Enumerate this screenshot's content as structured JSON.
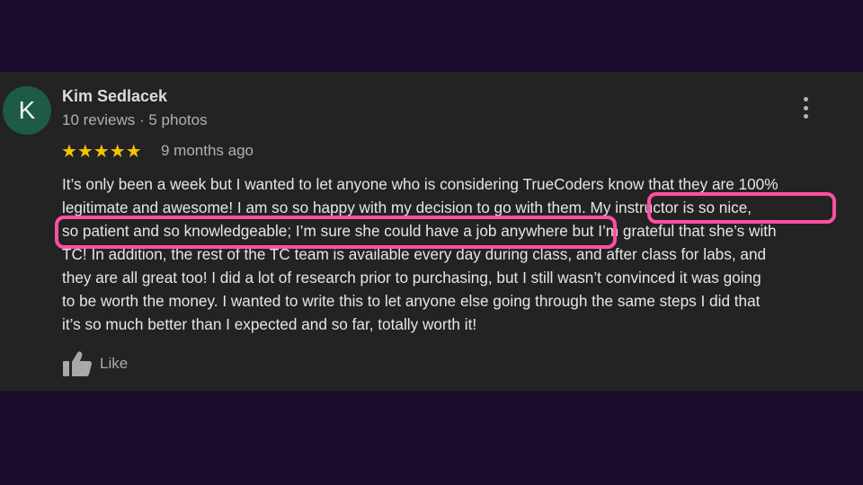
{
  "review": {
    "avatar_letter": "K",
    "reviewer_name": "Kim Sedlacek",
    "reviewer_meta": "10 reviews · 5 photos",
    "stars": "★★★★★",
    "rating": 5,
    "time": "9 months ago",
    "lines": [
      "It’s only been a week but I wanted to let anyone who is considering TrueCoders know that they are 100%",
      "legitimate and awesome!  I am so so happy with my decision to go with them.  My instructor is so nice,",
      "so patient and so knowledgeable; I’m sure she could have a job anywhere but I’m grateful that she’s with",
      "TC!  In addition, the rest of the TC team is available every day during class, and after class for labs, and",
      "they are all great too!  I did a lot of research prior to purchasing, but I still wasn’t convinced it was going",
      "to be worth the money.  I wanted to write this to let anyone else going through the same steps I did that",
      "it’s so much better than I expected and so far, totally worth it!"
    ],
    "like_label": "Like"
  },
  "colors": {
    "page_background": "#1b0d2e",
    "card_background": "#232323",
    "avatar": "#1e5a48",
    "star": "#f7c300",
    "highlight": "#ff4fa3"
  },
  "icons": {
    "menu": "more-vert-icon",
    "like": "thumbs-up-icon"
  }
}
